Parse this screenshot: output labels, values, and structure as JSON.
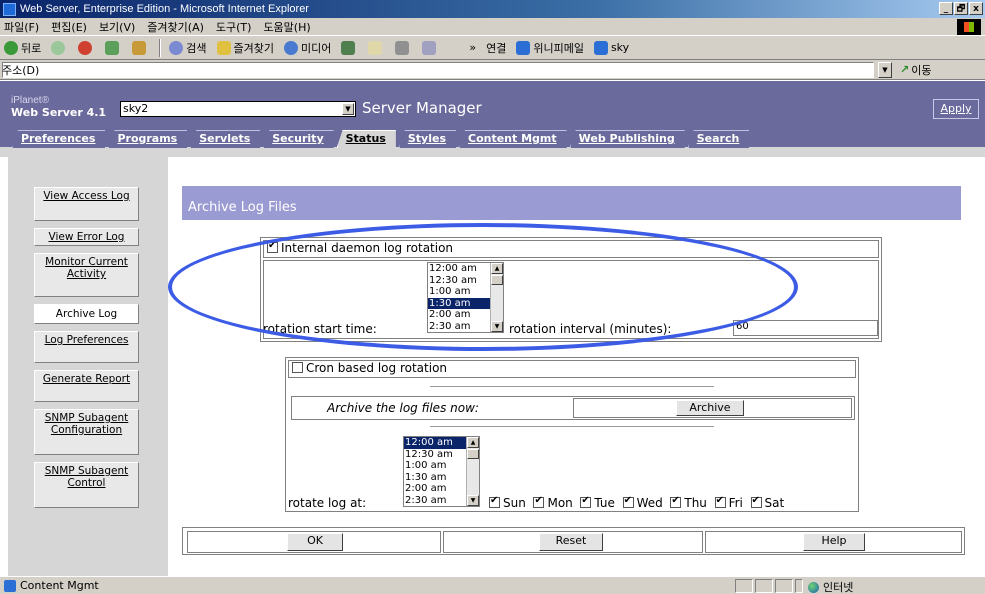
{
  "window": {
    "title": "Web Server, Enterprise Edition - Microsoft Internet Explorer",
    "controls": [
      "_",
      "🗗",
      "x"
    ]
  },
  "menu": [
    "파일(F)",
    "편집(E)",
    "보기(V)",
    "즐겨찾기(A)",
    "도구(T)",
    "도움말(H)"
  ],
  "toolbar": {
    "back": "뒤로",
    "search": "검색",
    "favorites": "즐겨찾기",
    "media": "미디어",
    "links_label": "연결",
    "link1": "위니피메일",
    "link2": "sky"
  },
  "address": {
    "label": "주소(D)",
    "value": "",
    "go": "이동"
  },
  "header": {
    "brand_small": "iPlanet®",
    "brand": "Web Server 4.1",
    "server": "sky2",
    "title": "Server Manager",
    "apply": "Apply"
  },
  "tabs": [
    "Preferences",
    "Programs",
    "Servlets",
    "Security",
    "Status",
    "Styles",
    "Content Mgmt",
    "Web Publishing",
    "Search"
  ],
  "active_tab": "Status",
  "nav": {
    "view_access_log": "View Access Log",
    "view_error_log": "View Error Log",
    "monitor": "Monitor Current Activity",
    "archive_log": "Archive Log",
    "log_preferences": "Log Preferences",
    "generate_report": "Generate Report",
    "snmp_config": "SNMP Subagent Configuration",
    "snmp_control": "SNMP Subagent Control"
  },
  "page": {
    "title": "Archive Log Files",
    "internal": {
      "label": "Internal daemon log rotation",
      "checked": true,
      "start_label": "rotation start time:",
      "times": [
        "12:00 am",
        "12:30 am",
        "1:00 am",
        "1:30 am",
        "2:00 am",
        "2:30 am"
      ],
      "selected_time": "1:30 am",
      "interval_label": "rotation interval (minutes):",
      "interval_value": "60"
    },
    "cron": {
      "label": "Cron based log rotation",
      "checked": false,
      "archive_now_label": "Archive the log files now:",
      "archive_button": "Archive",
      "rotate_at_label": "rotate log at:",
      "times": [
        "12:00 am",
        "12:30 am",
        "1:00 am",
        "1:30 am",
        "2:00 am",
        "2:30 am"
      ],
      "selected_time": "12:00 am",
      "days": [
        {
          "label": "Sun",
          "checked": true
        },
        {
          "label": "Mon",
          "checked": true
        },
        {
          "label": "Tue",
          "checked": true
        },
        {
          "label": "Wed",
          "checked": true
        },
        {
          "label": "Thu",
          "checked": true
        },
        {
          "label": "Fri",
          "checked": true
        },
        {
          "label": "Sat",
          "checked": true
        }
      ]
    },
    "buttons": {
      "ok": "OK",
      "reset": "Reset",
      "help": "Help"
    }
  },
  "status": {
    "text": "Content Mgmt",
    "zone": "인터넷"
  },
  "colors": {
    "header": "#6b6a9c",
    "title_band": "#9b9bd3",
    "annotation_ellipse": "#3d5ce6",
    "selection": "#0a246a"
  }
}
